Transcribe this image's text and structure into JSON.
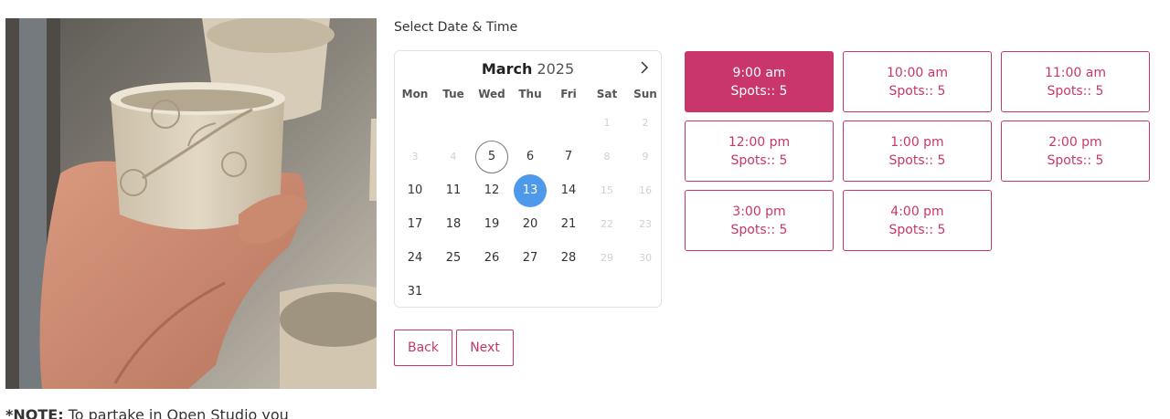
{
  "section_label": "Select Date & Time",
  "calendar": {
    "month": "March",
    "year": "2025",
    "weekdays": [
      "Mon",
      "Tue",
      "Wed",
      "Thu",
      "Fri",
      "Sat",
      "Sun"
    ],
    "weeks": [
      [
        null,
        null,
        null,
        null,
        null,
        {
          "d": "1",
          "s": "disabled"
        },
        {
          "d": "2",
          "s": "disabled"
        }
      ],
      [
        {
          "d": "3",
          "s": "disabled"
        },
        {
          "d": "4",
          "s": "disabled"
        },
        {
          "d": "5",
          "s": "today"
        },
        {
          "d": "6",
          "s": ""
        },
        {
          "d": "7",
          "s": ""
        },
        {
          "d": "8",
          "s": "disabled"
        },
        {
          "d": "9",
          "s": "disabled"
        }
      ],
      [
        {
          "d": "10",
          "s": ""
        },
        {
          "d": "11",
          "s": ""
        },
        {
          "d": "12",
          "s": ""
        },
        {
          "d": "13",
          "s": "selected"
        },
        {
          "d": "14",
          "s": ""
        },
        {
          "d": "15",
          "s": "disabled"
        },
        {
          "d": "16",
          "s": "disabled"
        }
      ],
      [
        {
          "d": "17",
          "s": ""
        },
        {
          "d": "18",
          "s": ""
        },
        {
          "d": "19",
          "s": ""
        },
        {
          "d": "20",
          "s": ""
        },
        {
          "d": "21",
          "s": ""
        },
        {
          "d": "22",
          "s": "disabled"
        },
        {
          "d": "23",
          "s": "disabled"
        }
      ],
      [
        {
          "d": "24",
          "s": ""
        },
        {
          "d": "25",
          "s": ""
        },
        {
          "d": "26",
          "s": ""
        },
        {
          "d": "27",
          "s": ""
        },
        {
          "d": "28",
          "s": ""
        },
        {
          "d": "29",
          "s": "disabled"
        },
        {
          "d": "30",
          "s": "disabled"
        }
      ],
      [
        {
          "d": "31",
          "s": ""
        },
        null,
        null,
        null,
        null,
        null,
        null
      ]
    ],
    "next_icon": "chevron-right-icon"
  },
  "buttons": {
    "back": "Back",
    "next": "Next"
  },
  "slots": [
    {
      "time": "9:00 am",
      "spots": "Spots:: 5",
      "active": true
    },
    {
      "time": "10:00 am",
      "spots": "Spots:: 5",
      "active": false
    },
    {
      "time": "11:00 am",
      "spots": "Spots:: 5",
      "active": false
    },
    {
      "time": "12:00 pm",
      "spots": "Spots:: 5",
      "active": false
    },
    {
      "time": "1:00 pm",
      "spots": "Spots:: 5",
      "active": false
    },
    {
      "time": "2:00 pm",
      "spots": "Spots:: 5",
      "active": false
    },
    {
      "time": "3:00 pm",
      "spots": "Spots:: 5",
      "active": false
    },
    {
      "time": "4:00 pm",
      "spots": "Spots:: 5",
      "active": false
    }
  ],
  "note": {
    "label": "*NOTE:",
    "text": " To partake in Open Studio you"
  },
  "colors": {
    "accent": "#c8366b",
    "selected_day": "#4f99ea"
  }
}
